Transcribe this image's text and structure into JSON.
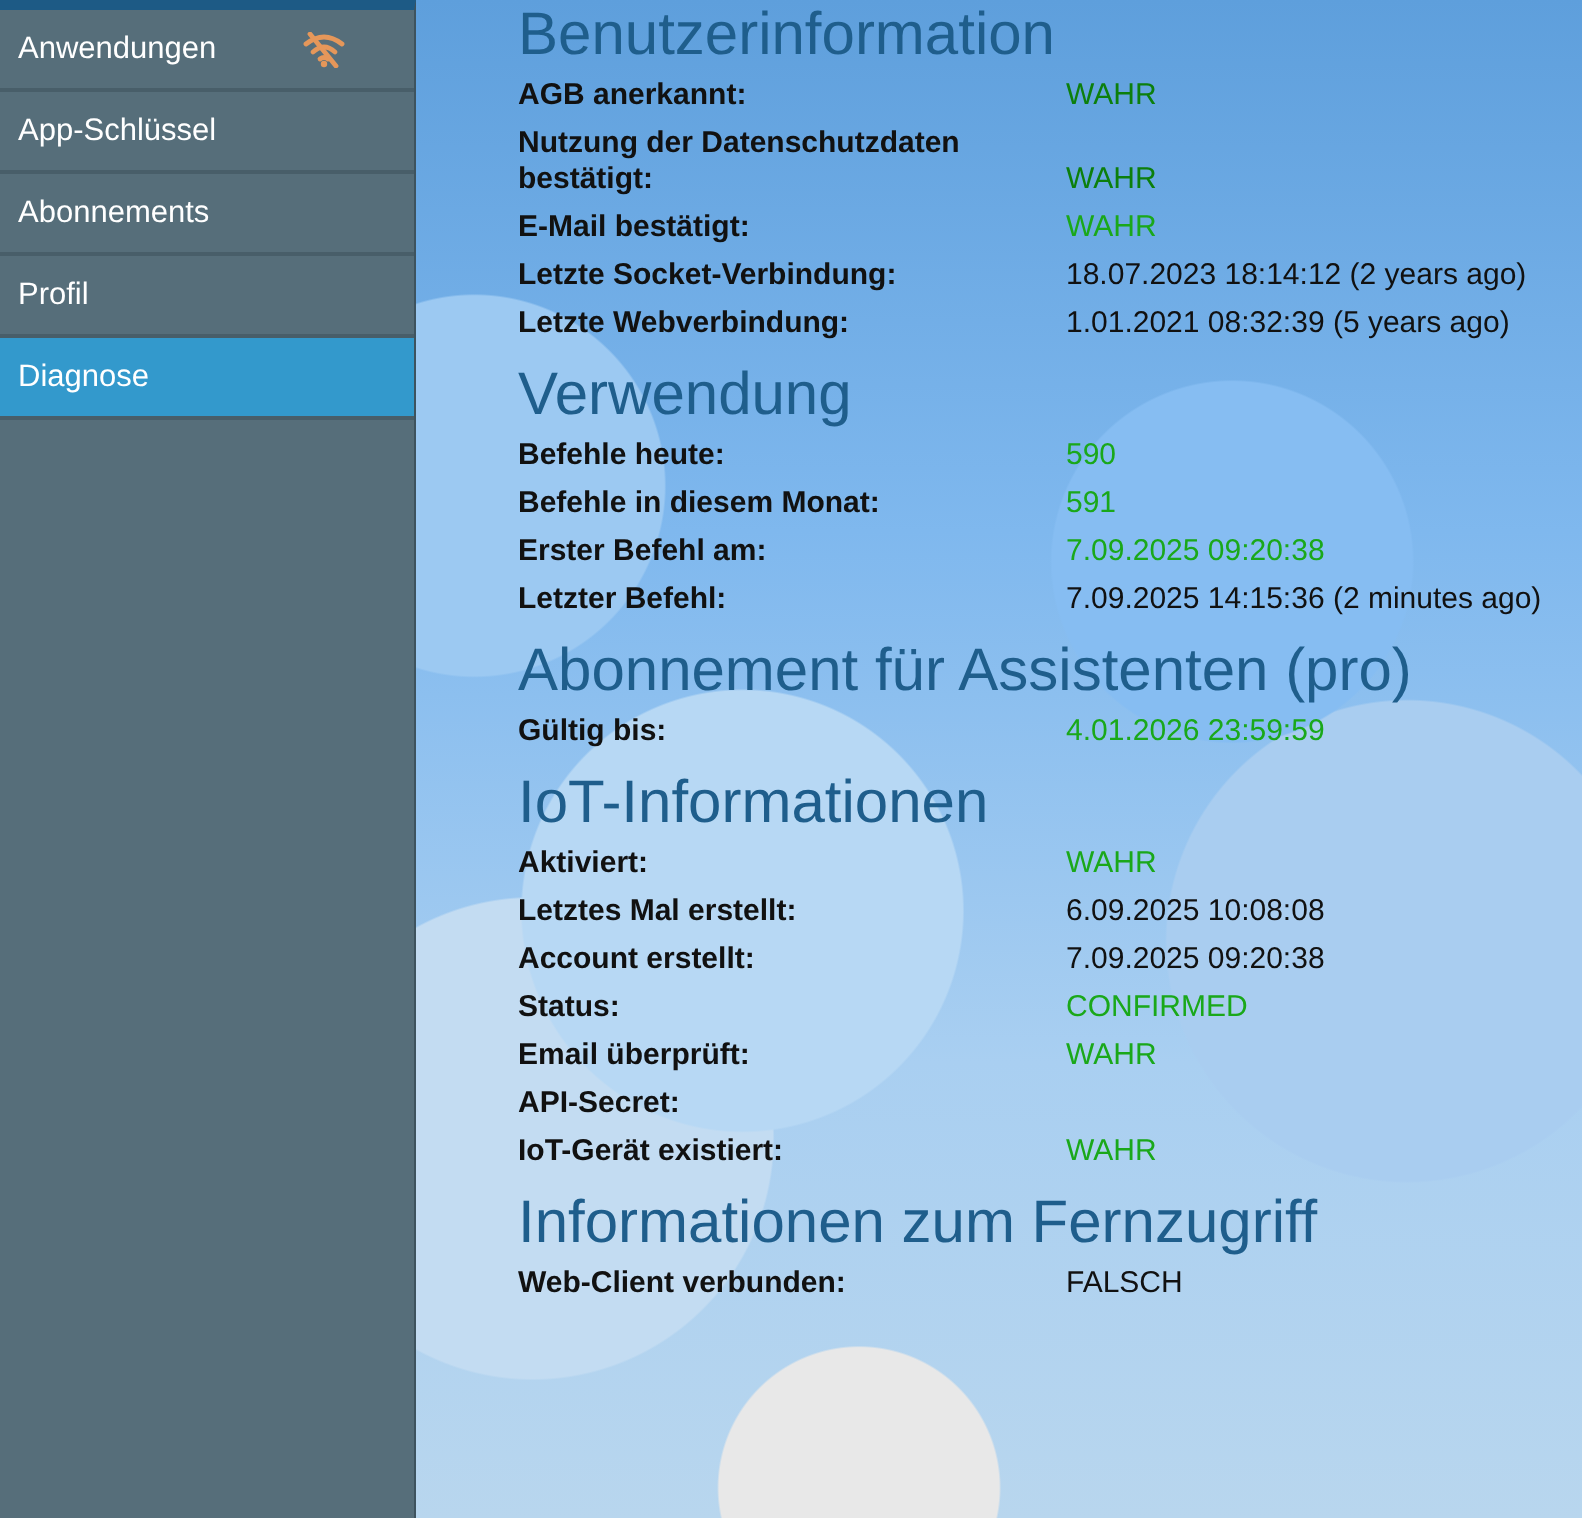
{
  "sidebar": {
    "items": [
      {
        "label": "Anwendungen",
        "selected": false,
        "offline": true
      },
      {
        "label": "App-Schlüssel",
        "selected": false
      },
      {
        "label": "Abonnements",
        "selected": false
      },
      {
        "label": "Profil",
        "selected": false
      },
      {
        "label": "Diagnose",
        "selected": true
      }
    ]
  },
  "sections": [
    {
      "title": "Benutzerinformation",
      "rows": [
        {
          "label": "AGB anerkannt:",
          "value": "WAHR",
          "color": "#0c7f0c"
        },
        {
          "label": "Nutzung der Datenschutzdaten bestätigt:",
          "value": "WAHR",
          "color": "#0c7f0c"
        },
        {
          "label": "E-Mail bestätigt:",
          "value": "WAHR",
          "color": "#1aa81a"
        },
        {
          "label": "Letzte Socket-Verbindung:",
          "value": "18.07.2023 18:14:12 (2 years ago)",
          "color": "#111111"
        },
        {
          "label": "Letzte Webverbindung:",
          "value": "1.01.2021 08:32:39 (5 years ago)",
          "color": "#111111"
        }
      ]
    },
    {
      "title": "Verwendung",
      "rows": [
        {
          "label": "Befehle heute:",
          "value": "590",
          "color": "#1aa81a"
        },
        {
          "label": "Befehle in diesem Monat:",
          "value": "591",
          "color": "#1aa81a"
        },
        {
          "label": "Erster Befehl am:",
          "value": "7.09.2025 09:20:38",
          "color": "#1aa81a"
        },
        {
          "label": "Letzter Befehl:",
          "value": "7.09.2025 14:15:36 (2 minutes ago)",
          "color": "#111111"
        }
      ]
    },
    {
      "title": "Abonnement für Assistenten (pro)",
      "rows": [
        {
          "label": "Gültig bis:",
          "value": "4.01.2026 23:59:59",
          "color": "#1aa81a"
        }
      ]
    },
    {
      "title": "IoT-Informationen",
      "rows": [
        {
          "label": "Aktiviert:",
          "value": "WAHR",
          "color": "#1aa81a"
        },
        {
          "label": "Letztes Mal erstellt:",
          "value": "6.09.2025 10:08:08",
          "color": "#111111"
        },
        {
          "label": "Account erstellt:",
          "value": "7.09.2025 09:20:38",
          "color": "#111111"
        },
        {
          "label": "Status:",
          "value": "CONFIRMED",
          "color": "#1aa81a"
        },
        {
          "label": "Email überprüft:",
          "value": "WAHR",
          "color": "#1aa81a"
        },
        {
          "label": "API-Secret:"
        },
        {
          "label": "IoT-Gerät existiert:",
          "value": "WAHR",
          "color": "#1aa81a"
        }
      ]
    },
    {
      "title": "Informationen zum Fernzugriff",
      "rows": [
        {
          "label": "Web-Client verbunden:",
          "value": "FALSCH",
          "color": "#111111"
        }
      ]
    }
  ]
}
